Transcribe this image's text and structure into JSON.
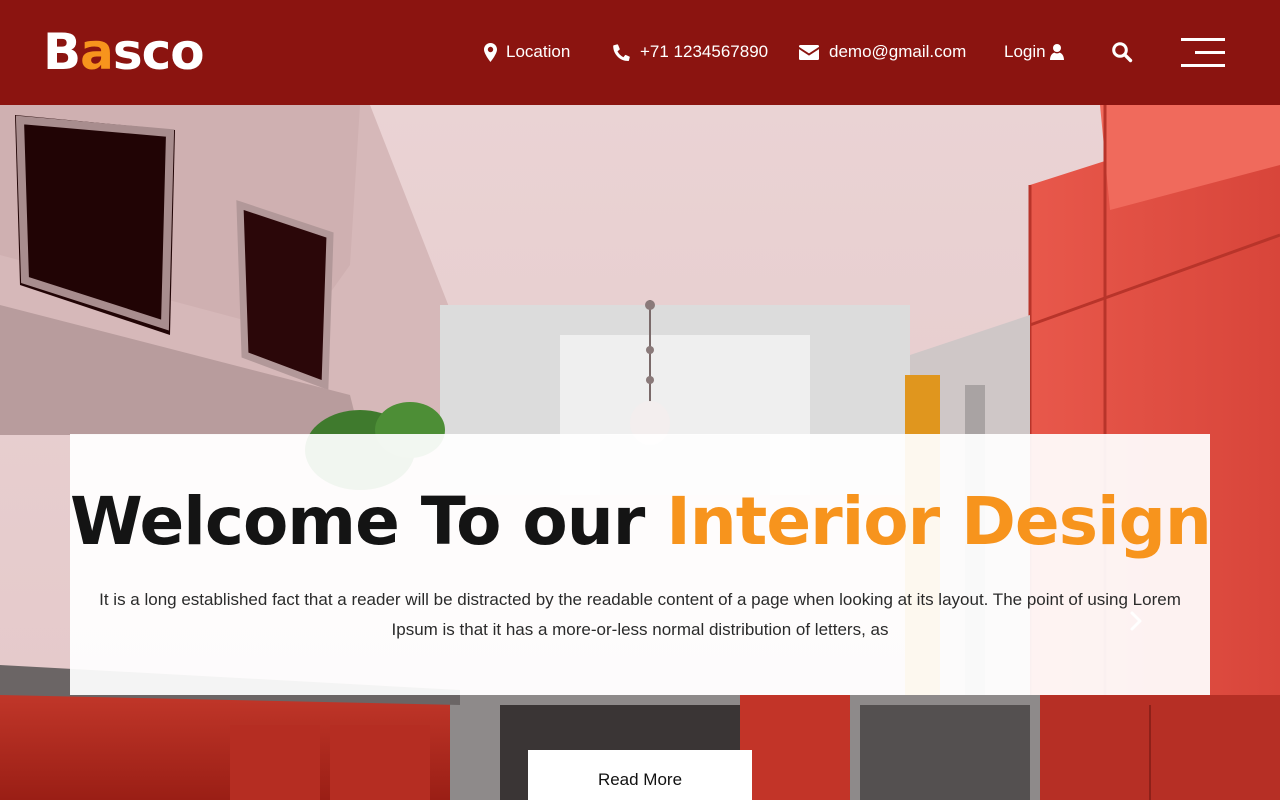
{
  "brand": {
    "logo_first": "B",
    "logo_accent": "a",
    "logo_rest": "sco",
    "accent_color": "#f7941d",
    "header_color": "#8b1410"
  },
  "nav": {
    "location": {
      "icon": "map-marker-icon",
      "label": "Location"
    },
    "phone": {
      "icon": "phone-icon",
      "label": "+71 1234567890"
    },
    "email": {
      "icon": "envelope-icon",
      "label": "demo@gmail.com"
    },
    "login": {
      "icon": "user-icon",
      "label": "Login"
    },
    "search": {
      "icon": "search-icon"
    },
    "menu": {
      "icon": "hamburger-menu-icon"
    }
  },
  "hero": {
    "title_part1": "Welcome To our ",
    "title_part2": "Interior Design",
    "description": "It is a long established fact that a reader will be distracted by the readable content of a page when looking at its layout. The point of using Lorem Ipsum is that it has a more-or-less normal distribution of letters, as",
    "read_more_label": "Read More",
    "next_icon": "chevron-right-icon"
  }
}
